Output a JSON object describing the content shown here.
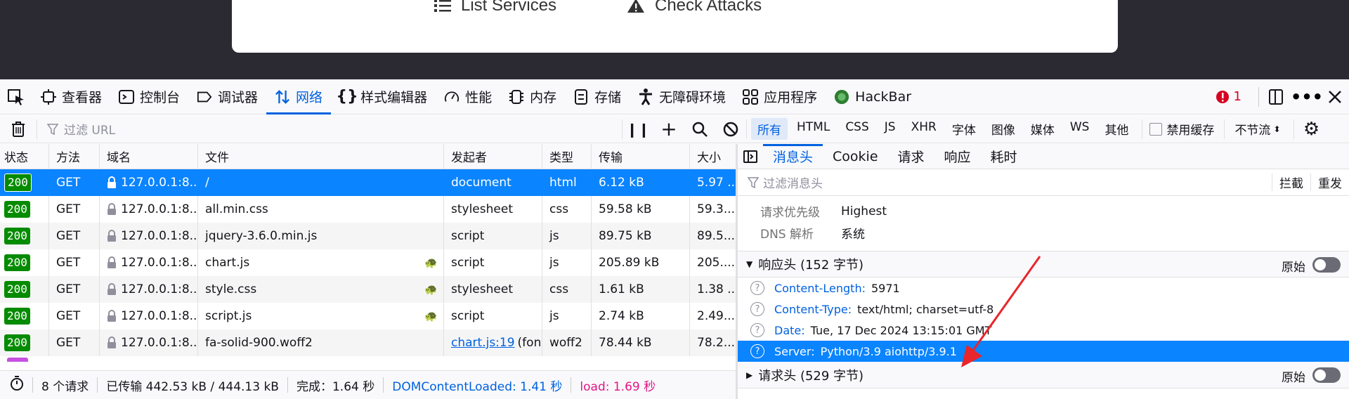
{
  "page": {
    "links": [
      {
        "label": "List Services",
        "icon": "list-icon"
      },
      {
        "label": "Check Attacks",
        "icon": "warning-icon"
      }
    ]
  },
  "devtools": {
    "tabs": [
      {
        "label": "查看器",
        "icon": "inspector-icon"
      },
      {
        "label": "控制台",
        "icon": "console-icon"
      },
      {
        "label": "调试器",
        "icon": "debugger-icon"
      },
      {
        "label": "网络",
        "icon": "network-icon"
      },
      {
        "label": "样式编辑器",
        "icon": "style-editor-icon"
      },
      {
        "label": "性能",
        "icon": "performance-icon"
      },
      {
        "label": "内存",
        "icon": "memory-icon"
      },
      {
        "label": "存储",
        "icon": "storage-icon"
      },
      {
        "label": "无障碍环境",
        "icon": "accessibility-icon"
      },
      {
        "label": "应用程序",
        "icon": "application-icon"
      },
      {
        "label": "HackBar",
        "icon": "hackbar-icon"
      }
    ],
    "error_count": "1",
    "toolbar": {
      "filter_placeholder": "过滤 URL",
      "filters": [
        "所有",
        "HTML",
        "CSS",
        "JS",
        "XHR",
        "字体",
        "图像",
        "媒体",
        "WS",
        "其他"
      ],
      "disable_cache": "禁用缓存",
      "throttle": "不节流"
    },
    "table": {
      "headers": [
        "状态",
        "方法",
        "域名",
        "文件",
        "发起者",
        "类型",
        "传输",
        "大小"
      ],
      "rows": [
        {
          "status": "200",
          "method": "GET",
          "domain": "127.0.0.1:8...",
          "file": "/",
          "initiator": "document",
          "type": "html",
          "transfer": "6.12 kB",
          "size": "5.97 ..."
        },
        {
          "status": "200",
          "method": "GET",
          "domain": "127.0.0.1:8...",
          "file": "all.min.css",
          "initiator": "stylesheet",
          "type": "css",
          "transfer": "59.58 kB",
          "size": "59.3..."
        },
        {
          "status": "200",
          "method": "GET",
          "domain": "127.0.0.1:8...",
          "file": "jquery-3.6.0.min.js",
          "initiator": "script",
          "type": "js",
          "transfer": "89.75 kB",
          "size": "89.5..."
        },
        {
          "status": "200",
          "method": "GET",
          "domain": "127.0.0.1:8...",
          "file": "chart.js",
          "initiator": "script",
          "type": "js",
          "transfer": "205.89 kB",
          "size": "205...."
        },
        {
          "status": "200",
          "method": "GET",
          "domain": "127.0.0.1:8...",
          "file": "style.css",
          "initiator": "stylesheet",
          "type": "css",
          "transfer": "1.61 kB",
          "size": "1.38 ..."
        },
        {
          "status": "200",
          "method": "GET",
          "domain": "127.0.0.1:8...",
          "file": "script.js",
          "initiator": "script",
          "type": "js",
          "transfer": "2.74 kB",
          "size": "2.49..."
        },
        {
          "status": "200",
          "method": "GET",
          "domain": "127.0.0.1:8...",
          "file": "fa-solid-900.woff2",
          "initiator": "chart.js:19",
          "initiator_suffix": "(font)",
          "type": "woff2",
          "transfer": "78.44 kB",
          "size": "78.2..."
        }
      ]
    },
    "footer": {
      "requests": "8 个请求",
      "transferred": "已传输 442.53 kB / 444.13 kB",
      "finish": "完成：1.64 秒",
      "dom": "DOMContentLoaded: 1.41 秒",
      "load": "load: 1.69 秒"
    },
    "side": {
      "tabs": [
        "消息头",
        "Cookie",
        "请求",
        "响应",
        "耗时"
      ],
      "filter_placeholder": "过滤消息头",
      "block": "拦截",
      "resend": "重发",
      "info": [
        {
          "k": "请求优先级",
          "v": "Highest"
        },
        {
          "k": "DNS 解析",
          "v": "系统"
        }
      ],
      "resp_section": "响应头 (152 字节)",
      "raw": "原始",
      "headers": [
        {
          "name": "Content-Length:",
          "value": "5971"
        },
        {
          "name": "Content-Type:",
          "value": "text/html; charset=utf-8"
        },
        {
          "name": "Date:",
          "value": "Tue, 17 Dec 2024 13:15:01 GMT"
        },
        {
          "name": "Server:",
          "value": "Python/3.9 aiohttp/3.9.1"
        }
      ],
      "req_section": "请求头 (529 字节)"
    }
  }
}
